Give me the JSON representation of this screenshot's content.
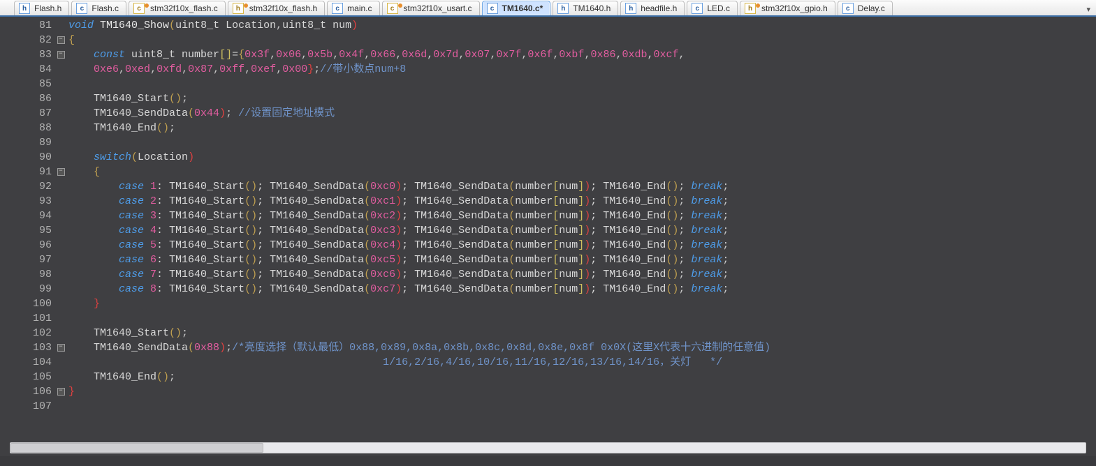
{
  "tabs": [
    {
      "label": "Flash.h",
      "kind": "h",
      "dirty": false,
      "active": false
    },
    {
      "label": "Flash.c",
      "kind": "c",
      "dirty": false,
      "active": false
    },
    {
      "label": "stm32f10x_flash.c",
      "kind": "cy",
      "dirty": true,
      "active": false
    },
    {
      "label": "stm32f10x_flash.h",
      "kind": "hy",
      "dirty": true,
      "active": false
    },
    {
      "label": "main.c",
      "kind": "c",
      "dirty": false,
      "active": false
    },
    {
      "label": "stm32f10x_usart.c",
      "kind": "cy",
      "dirty": true,
      "active": false
    },
    {
      "label": "TM1640.c*",
      "kind": "c",
      "dirty": false,
      "active": true
    },
    {
      "label": "TM1640.h",
      "kind": "h",
      "dirty": false,
      "active": false
    },
    {
      "label": "headfile.h",
      "kind": "h",
      "dirty": false,
      "active": false
    },
    {
      "label": "LED.c",
      "kind": "c",
      "dirty": false,
      "active": false
    },
    {
      "label": "stm32f10x_gpio.h",
      "kind": "hy",
      "dirty": true,
      "active": false
    },
    {
      "label": "Delay.c",
      "kind": "c",
      "dirty": false,
      "active": false
    }
  ],
  "overflow_glyph": "▾",
  "line_start": 81,
  "fold_markers": {
    "82": "-",
    "83": "-",
    "91": "-",
    "103": "-",
    "106": "-"
  },
  "colors": {
    "bg": "#3f3f42",
    "keyword": "#4e9ce8",
    "number": "#e25da0",
    "comment": "#6f93c9",
    "brace_open": "#c0a050",
    "brace_close": "#e04040"
  },
  "code_lines": [
    [
      {
        "t": "void ",
        "c": "c-kw"
      },
      {
        "t": "TM1640_Show",
        "c": "c-fn"
      },
      {
        "t": "(",
        "c": "c-brace"
      },
      {
        "t": "uint8_t Location",
        "c": "c-param"
      },
      {
        "t": ",",
        "c": "c-punc"
      },
      {
        "t": "uint8_t num",
        "c": "c-param"
      },
      {
        "t": ")",
        "c": "c-braceR"
      }
    ],
    [
      {
        "t": "{",
        "c": "c-brace"
      }
    ],
    [
      {
        "t": "    ",
        "c": ""
      },
      {
        "t": "const ",
        "c": "c-const"
      },
      {
        "t": "uint8_t number",
        "c": "c-ident"
      },
      {
        "t": "[]",
        "c": "c-arr"
      },
      {
        "t": "=",
        "c": "c-op"
      },
      {
        "t": "{",
        "c": "c-brace"
      },
      {
        "t": "0x3f",
        "c": "c-num"
      },
      {
        "t": ",",
        "c": "c-punc"
      },
      {
        "t": "0x06",
        "c": "c-num"
      },
      {
        "t": ",",
        "c": "c-punc"
      },
      {
        "t": "0x5b",
        "c": "c-num"
      },
      {
        "t": ",",
        "c": "c-punc"
      },
      {
        "t": "0x4f",
        "c": "c-num"
      },
      {
        "t": ",",
        "c": "c-punc"
      },
      {
        "t": "0x66",
        "c": "c-num"
      },
      {
        "t": ",",
        "c": "c-punc"
      },
      {
        "t": "0x6d",
        "c": "c-num"
      },
      {
        "t": ",",
        "c": "c-punc"
      },
      {
        "t": "0x7d",
        "c": "c-num"
      },
      {
        "t": ",",
        "c": "c-punc"
      },
      {
        "t": "0x07",
        "c": "c-num"
      },
      {
        "t": ",",
        "c": "c-punc"
      },
      {
        "t": "0x7f",
        "c": "c-num"
      },
      {
        "t": ",",
        "c": "c-punc"
      },
      {
        "t": "0x6f",
        "c": "c-num"
      },
      {
        "t": ",",
        "c": "c-punc"
      },
      {
        "t": "0xbf",
        "c": "c-num"
      },
      {
        "t": ",",
        "c": "c-punc"
      },
      {
        "t": "0x86",
        "c": "c-num"
      },
      {
        "t": ",",
        "c": "c-punc"
      },
      {
        "t": "0xdb",
        "c": "c-num"
      },
      {
        "t": ",",
        "c": "c-punc"
      },
      {
        "t": "0xcf",
        "c": "c-num"
      },
      {
        "t": ",",
        "c": "c-punc"
      }
    ],
    [
      {
        "t": "    ",
        "c": ""
      },
      {
        "t": "0xe6",
        "c": "c-num"
      },
      {
        "t": ",",
        "c": "c-punc"
      },
      {
        "t": "0xed",
        "c": "c-num"
      },
      {
        "t": ",",
        "c": "c-punc"
      },
      {
        "t": "0xfd",
        "c": "c-num"
      },
      {
        "t": ",",
        "c": "c-punc"
      },
      {
        "t": "0x87",
        "c": "c-num"
      },
      {
        "t": ",",
        "c": "c-punc"
      },
      {
        "t": "0xff",
        "c": "c-num"
      },
      {
        "t": ",",
        "c": "c-punc"
      },
      {
        "t": "0xef",
        "c": "c-num"
      },
      {
        "t": ",",
        "c": "c-punc"
      },
      {
        "t": "0x00",
        "c": "c-num"
      },
      {
        "t": "}",
        "c": "c-braceR"
      },
      {
        "t": ";",
        "c": "c-punc"
      },
      {
        "t": "//带小数点num+8",
        "c": "c-comment"
      }
    ],
    [
      {
        "t": "",
        "c": ""
      }
    ],
    [
      {
        "t": "    TM1640_Start",
        "c": "c-fncall"
      },
      {
        "t": "()",
        "c": "c-brace"
      },
      {
        "t": ";",
        "c": "c-punc"
      }
    ],
    [
      {
        "t": "    TM1640_SendData",
        "c": "c-fncall"
      },
      {
        "t": "(",
        "c": "c-brace"
      },
      {
        "t": "0x44",
        "c": "c-num"
      },
      {
        "t": ")",
        "c": "c-braceR"
      },
      {
        "t": "; ",
        "c": "c-punc"
      },
      {
        "t": "//设置固定地址模式",
        "c": "c-comment"
      }
    ],
    [
      {
        "t": "    TM1640_End",
        "c": "c-fncall"
      },
      {
        "t": "()",
        "c": "c-brace"
      },
      {
        "t": ";",
        "c": "c-punc"
      }
    ],
    [
      {
        "t": "",
        "c": ""
      }
    ],
    [
      {
        "t": "    ",
        "c": ""
      },
      {
        "t": "switch",
        "c": "c-kw"
      },
      {
        "t": "(",
        "c": "c-brace"
      },
      {
        "t": "Location",
        "c": "c-ident"
      },
      {
        "t": ")",
        "c": "c-braceR"
      }
    ],
    [
      {
        "t": "    {",
        "c": "c-brace"
      }
    ],
    [
      {
        "t": "        ",
        "c": ""
      },
      {
        "t": "case ",
        "c": "c-kw"
      },
      {
        "t": "1",
        "c": "c-num"
      },
      {
        "t": ": TM1640_Start",
        "c": "c-fncall"
      },
      {
        "t": "()",
        "c": "c-brace"
      },
      {
        "t": "; TM1640_SendData",
        "c": "c-fncall"
      },
      {
        "t": "(",
        "c": "c-brace"
      },
      {
        "t": "0xc0",
        "c": "c-num"
      },
      {
        "t": ")",
        "c": "c-braceR"
      },
      {
        "t": "; TM1640_SendData",
        "c": "c-fncall"
      },
      {
        "t": "(",
        "c": "c-brace"
      },
      {
        "t": "number",
        "c": "c-ident"
      },
      {
        "t": "[",
        "c": "c-arr"
      },
      {
        "t": "num",
        "c": "c-ident"
      },
      {
        "t": "]",
        "c": "c-arr"
      },
      {
        "t": ")",
        "c": "c-braceR"
      },
      {
        "t": "; TM1640_End",
        "c": "c-fncall"
      },
      {
        "t": "()",
        "c": "c-brace"
      },
      {
        "t": "; ",
        "c": "c-punc"
      },
      {
        "t": "break",
        "c": "c-kw"
      },
      {
        "t": ";",
        "c": "c-punc"
      }
    ],
    [
      {
        "t": "        ",
        "c": ""
      },
      {
        "t": "case ",
        "c": "c-kw"
      },
      {
        "t": "2",
        "c": "c-num"
      },
      {
        "t": ": TM1640_Start",
        "c": "c-fncall"
      },
      {
        "t": "()",
        "c": "c-brace"
      },
      {
        "t": "; TM1640_SendData",
        "c": "c-fncall"
      },
      {
        "t": "(",
        "c": "c-brace"
      },
      {
        "t": "0xc1",
        "c": "c-num"
      },
      {
        "t": ")",
        "c": "c-braceR"
      },
      {
        "t": "; TM1640_SendData",
        "c": "c-fncall"
      },
      {
        "t": "(",
        "c": "c-brace"
      },
      {
        "t": "number",
        "c": "c-ident"
      },
      {
        "t": "[",
        "c": "c-arr"
      },
      {
        "t": "num",
        "c": "c-ident"
      },
      {
        "t": "]",
        "c": "c-arr"
      },
      {
        "t": ")",
        "c": "c-braceR"
      },
      {
        "t": "; TM1640_End",
        "c": "c-fncall"
      },
      {
        "t": "()",
        "c": "c-brace"
      },
      {
        "t": "; ",
        "c": "c-punc"
      },
      {
        "t": "break",
        "c": "c-kw"
      },
      {
        "t": ";",
        "c": "c-punc"
      }
    ],
    [
      {
        "t": "        ",
        "c": ""
      },
      {
        "t": "case ",
        "c": "c-kw"
      },
      {
        "t": "3",
        "c": "c-num"
      },
      {
        "t": ": TM1640_Start",
        "c": "c-fncall"
      },
      {
        "t": "()",
        "c": "c-brace"
      },
      {
        "t": "; TM1640_SendData",
        "c": "c-fncall"
      },
      {
        "t": "(",
        "c": "c-brace"
      },
      {
        "t": "0xc2",
        "c": "c-num"
      },
      {
        "t": ")",
        "c": "c-braceR"
      },
      {
        "t": "; TM1640_SendData",
        "c": "c-fncall"
      },
      {
        "t": "(",
        "c": "c-brace"
      },
      {
        "t": "number",
        "c": "c-ident"
      },
      {
        "t": "[",
        "c": "c-arr"
      },
      {
        "t": "num",
        "c": "c-ident"
      },
      {
        "t": "]",
        "c": "c-arr"
      },
      {
        "t": ")",
        "c": "c-braceR"
      },
      {
        "t": "; TM1640_End",
        "c": "c-fncall"
      },
      {
        "t": "()",
        "c": "c-brace"
      },
      {
        "t": "; ",
        "c": "c-punc"
      },
      {
        "t": "break",
        "c": "c-kw"
      },
      {
        "t": ";",
        "c": "c-punc"
      }
    ],
    [
      {
        "t": "        ",
        "c": ""
      },
      {
        "t": "case ",
        "c": "c-kw"
      },
      {
        "t": "4",
        "c": "c-num"
      },
      {
        "t": ": TM1640_Start",
        "c": "c-fncall"
      },
      {
        "t": "()",
        "c": "c-brace"
      },
      {
        "t": "; TM1640_SendData",
        "c": "c-fncall"
      },
      {
        "t": "(",
        "c": "c-brace"
      },
      {
        "t": "0xc3",
        "c": "c-num"
      },
      {
        "t": ")",
        "c": "c-braceR"
      },
      {
        "t": "; TM1640_SendData",
        "c": "c-fncall"
      },
      {
        "t": "(",
        "c": "c-brace"
      },
      {
        "t": "number",
        "c": "c-ident"
      },
      {
        "t": "[",
        "c": "c-arr"
      },
      {
        "t": "num",
        "c": "c-ident"
      },
      {
        "t": "]",
        "c": "c-arr"
      },
      {
        "t": ")",
        "c": "c-braceR"
      },
      {
        "t": "; TM1640_End",
        "c": "c-fncall"
      },
      {
        "t": "()",
        "c": "c-brace"
      },
      {
        "t": "; ",
        "c": "c-punc"
      },
      {
        "t": "break",
        "c": "c-kw"
      },
      {
        "t": ";",
        "c": "c-punc"
      }
    ],
    [
      {
        "t": "        ",
        "c": ""
      },
      {
        "t": "case ",
        "c": "c-kw"
      },
      {
        "t": "5",
        "c": "c-num"
      },
      {
        "t": ": TM1640_Start",
        "c": "c-fncall"
      },
      {
        "t": "()",
        "c": "c-brace"
      },
      {
        "t": "; TM1640_SendData",
        "c": "c-fncall"
      },
      {
        "t": "(",
        "c": "c-brace"
      },
      {
        "t": "0xc4",
        "c": "c-num"
      },
      {
        "t": ")",
        "c": "c-braceR"
      },
      {
        "t": "; TM1640_SendData",
        "c": "c-fncall"
      },
      {
        "t": "(",
        "c": "c-brace"
      },
      {
        "t": "number",
        "c": "c-ident"
      },
      {
        "t": "[",
        "c": "c-arr"
      },
      {
        "t": "num",
        "c": "c-ident"
      },
      {
        "t": "]",
        "c": "c-arr"
      },
      {
        "t": ")",
        "c": "c-braceR"
      },
      {
        "t": "; TM1640_End",
        "c": "c-fncall"
      },
      {
        "t": "()",
        "c": "c-brace"
      },
      {
        "t": "; ",
        "c": "c-punc"
      },
      {
        "t": "break",
        "c": "c-kw"
      },
      {
        "t": ";",
        "c": "c-punc"
      }
    ],
    [
      {
        "t": "        ",
        "c": ""
      },
      {
        "t": "case ",
        "c": "c-kw"
      },
      {
        "t": "6",
        "c": "c-num"
      },
      {
        "t": ": TM1640_Start",
        "c": "c-fncall"
      },
      {
        "t": "()",
        "c": "c-brace"
      },
      {
        "t": "; TM1640_SendData",
        "c": "c-fncall"
      },
      {
        "t": "(",
        "c": "c-brace"
      },
      {
        "t": "0xc5",
        "c": "c-num"
      },
      {
        "t": ")",
        "c": "c-braceR"
      },
      {
        "t": "; TM1640_SendData",
        "c": "c-fncall"
      },
      {
        "t": "(",
        "c": "c-brace"
      },
      {
        "t": "number",
        "c": "c-ident"
      },
      {
        "t": "[",
        "c": "c-arr"
      },
      {
        "t": "num",
        "c": "c-ident"
      },
      {
        "t": "]",
        "c": "c-arr"
      },
      {
        "t": ")",
        "c": "c-braceR"
      },
      {
        "t": "; TM1640_End",
        "c": "c-fncall"
      },
      {
        "t": "()",
        "c": "c-brace"
      },
      {
        "t": "; ",
        "c": "c-punc"
      },
      {
        "t": "break",
        "c": "c-kw"
      },
      {
        "t": ";",
        "c": "c-punc"
      }
    ],
    [
      {
        "t": "        ",
        "c": ""
      },
      {
        "t": "case ",
        "c": "c-kw"
      },
      {
        "t": "7",
        "c": "c-num"
      },
      {
        "t": ": TM1640_Start",
        "c": "c-fncall"
      },
      {
        "t": "()",
        "c": "c-brace"
      },
      {
        "t": "; TM1640_SendData",
        "c": "c-fncall"
      },
      {
        "t": "(",
        "c": "c-brace"
      },
      {
        "t": "0xc6",
        "c": "c-num"
      },
      {
        "t": ")",
        "c": "c-braceR"
      },
      {
        "t": "; TM1640_SendData",
        "c": "c-fncall"
      },
      {
        "t": "(",
        "c": "c-brace"
      },
      {
        "t": "number",
        "c": "c-ident"
      },
      {
        "t": "[",
        "c": "c-arr"
      },
      {
        "t": "num",
        "c": "c-ident"
      },
      {
        "t": "]",
        "c": "c-arr"
      },
      {
        "t": ")",
        "c": "c-braceR"
      },
      {
        "t": "; TM1640_End",
        "c": "c-fncall"
      },
      {
        "t": "()",
        "c": "c-brace"
      },
      {
        "t": "; ",
        "c": "c-punc"
      },
      {
        "t": "break",
        "c": "c-kw"
      },
      {
        "t": ";",
        "c": "c-punc"
      }
    ],
    [
      {
        "t": "        ",
        "c": ""
      },
      {
        "t": "case ",
        "c": "c-kw"
      },
      {
        "t": "8",
        "c": "c-num"
      },
      {
        "t": ": TM1640_Start",
        "c": "c-fncall"
      },
      {
        "t": "()",
        "c": "c-brace"
      },
      {
        "t": "; TM1640_SendData",
        "c": "c-fncall"
      },
      {
        "t": "(",
        "c": "c-brace"
      },
      {
        "t": "0xc7",
        "c": "c-num"
      },
      {
        "t": ")",
        "c": "c-braceR"
      },
      {
        "t": "; TM1640_SendData",
        "c": "c-fncall"
      },
      {
        "t": "(",
        "c": "c-brace"
      },
      {
        "t": "number",
        "c": "c-ident"
      },
      {
        "t": "[",
        "c": "c-arr"
      },
      {
        "t": "num",
        "c": "c-ident"
      },
      {
        "t": "]",
        "c": "c-arr"
      },
      {
        "t": ")",
        "c": "c-braceR"
      },
      {
        "t": "; TM1640_End",
        "c": "c-fncall"
      },
      {
        "t": "()",
        "c": "c-brace"
      },
      {
        "t": "; ",
        "c": "c-punc"
      },
      {
        "t": "break",
        "c": "c-kw"
      },
      {
        "t": ";",
        "c": "c-punc"
      }
    ],
    [
      {
        "t": "    }",
        "c": "c-braceR"
      }
    ],
    [
      {
        "t": "",
        "c": ""
      }
    ],
    [
      {
        "t": "    TM1640_Start",
        "c": "c-fncall"
      },
      {
        "t": "()",
        "c": "c-brace"
      },
      {
        "t": ";",
        "c": "c-punc"
      }
    ],
    [
      {
        "t": "    TM1640_SendData",
        "c": "c-fncall"
      },
      {
        "t": "(",
        "c": "c-brace"
      },
      {
        "t": "0x88",
        "c": "c-num"
      },
      {
        "t": ")",
        "c": "c-braceR"
      },
      {
        "t": ";",
        "c": "c-punc"
      },
      {
        "t": "/*亮度选择（默认最低）0x88,0x89,0x8a,0x8b,0x8c,0x8d,0x8e,0x8f 0x0X(这里X代表十六进制的任意值)",
        "c": "c-comment"
      }
    ],
    [
      {
        "t": "                                                  1/16,2/16,4/16,10/16,11/16,12/16,13/16,14/16，关灯   */",
        "c": "c-comment"
      }
    ],
    [
      {
        "t": "    TM1640_End",
        "c": "c-fncall"
      },
      {
        "t": "()",
        "c": "c-brace"
      },
      {
        "t": ";",
        "c": "c-punc"
      }
    ],
    [
      {
        "t": "}",
        "c": "c-braceR"
      }
    ],
    [
      {
        "t": "",
        "c": ""
      }
    ]
  ]
}
